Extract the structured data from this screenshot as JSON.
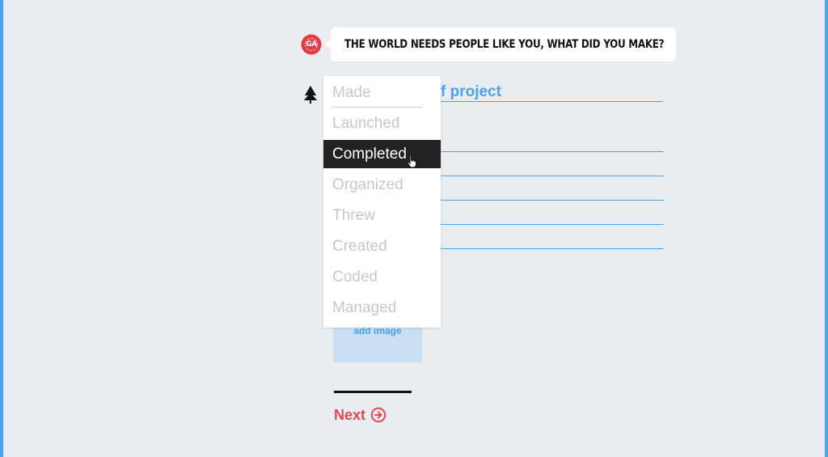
{
  "prompt": {
    "badge_text": "GA",
    "question": "THE WORLD NEEDS PEOPLE LIKE YOU, WHAT DID YOU MAKE?"
  },
  "form": {
    "title_value": "f project",
    "add_image_label": "add image",
    "next_label": "Next"
  },
  "verb_dropdown": {
    "options": [
      "Made",
      "Launched",
      "Completed",
      "Organized",
      "Threw",
      "Created",
      "Coded",
      "Managed"
    ],
    "selected": "Completed"
  },
  "colors": {
    "background": "#e9edf1",
    "accent_blue": "#4aa3ef",
    "next_red": "#e5484d",
    "badge_red": "#e63946",
    "selected_bg": "#222222"
  },
  "icons": {
    "badge": "ga-badge-icon",
    "tree": "tree-icon",
    "next": "arrow-circle-right-icon",
    "cursor": "hand-pointer-icon"
  }
}
